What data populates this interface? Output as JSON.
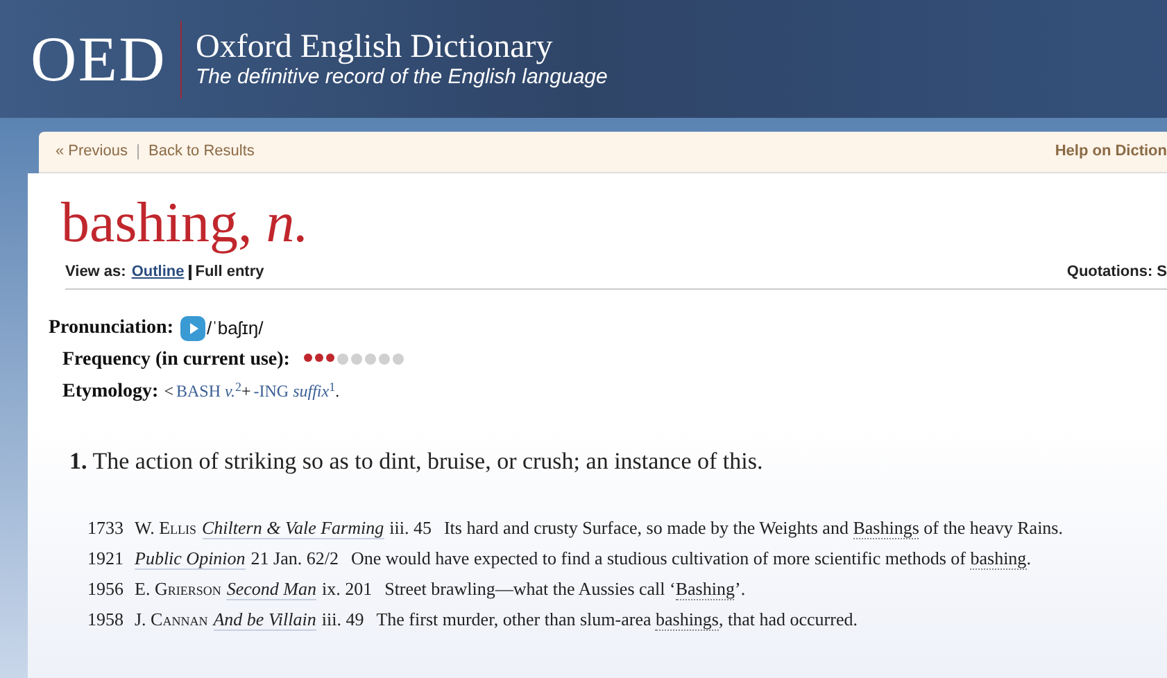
{
  "header": {
    "logo": "OED",
    "title": "Oxford English Dictionary",
    "tagline": "The definitive record of the English language"
  },
  "nav": {
    "links": [
      "« Previous",
      "Back to Results"
    ],
    "help": "Help on Diction"
  },
  "entry": {
    "headword": "bashing,",
    "pos": "n.",
    "view_as": {
      "label": "View as:",
      "options": [
        {
          "label": "Outline",
          "selected": false
        },
        {
          "label": "Full entry",
          "selected": true
        }
      ]
    },
    "quotations_label": "Quotations: S",
    "pronunciation": {
      "label": "Pronunciation:",
      "ipa": "/ˈbaʃɪŋ/"
    },
    "frequency": {
      "label": "Frequency (in current use):",
      "stars": 3
    },
    "etymology": {
      "label": "Etymology:",
      "prefix": "<",
      "parts": [
        {
          "kind": "link",
          "text": "BASH *v.*$^{2}$"
        },
        {
          "kind": "plain",
          "text": "+"
        },
        {
          "kind": "link",
          "text": "-ING *suffix*$^{1}$"
        },
        {
          "kind": "plain",
          "text": "."
        }
      ]
    },
    "senses": [
      {
        "number": "1.",
        "definition": "The action of striking so as to dint, bruise, or crush; an instance of this.",
        "quotations": [
          {
            "year": "1733",
            "author": "W. Ellis",
            "title": "Chiltern & Vale Farming",
            "ref": "iii. 45",
            "before": "Its hard and crusty Surface, so made by the Weights and ",
            "keyword": "Bashings",
            "after": " of the heavy Rains."
          },
          {
            "year": "1921",
            "title": "Public Opinion",
            "ref": "21 Jan. 62/2",
            "before": "One would have expected to find a studious cultivation of more scientific methods of ",
            "keyword": "bashing",
            "after": "."
          },
          {
            "year": "1956",
            "author": "E. Grierson",
            "title": "Second Man",
            "ref": "ix. 201",
            "before": "Street brawling—what the Aussies call ‘",
            "keyword": "Bashing",
            "after": "’."
          },
          {
            "year": "1958",
            "author": "J. Cannan",
            "title": "And be Villain",
            "ref": "iii. 49",
            "before": "The first murder, other than slum-area ",
            "keyword": "bashings",
            "after": ", that had occurred."
          }
        ]
      }
    ]
  }
}
